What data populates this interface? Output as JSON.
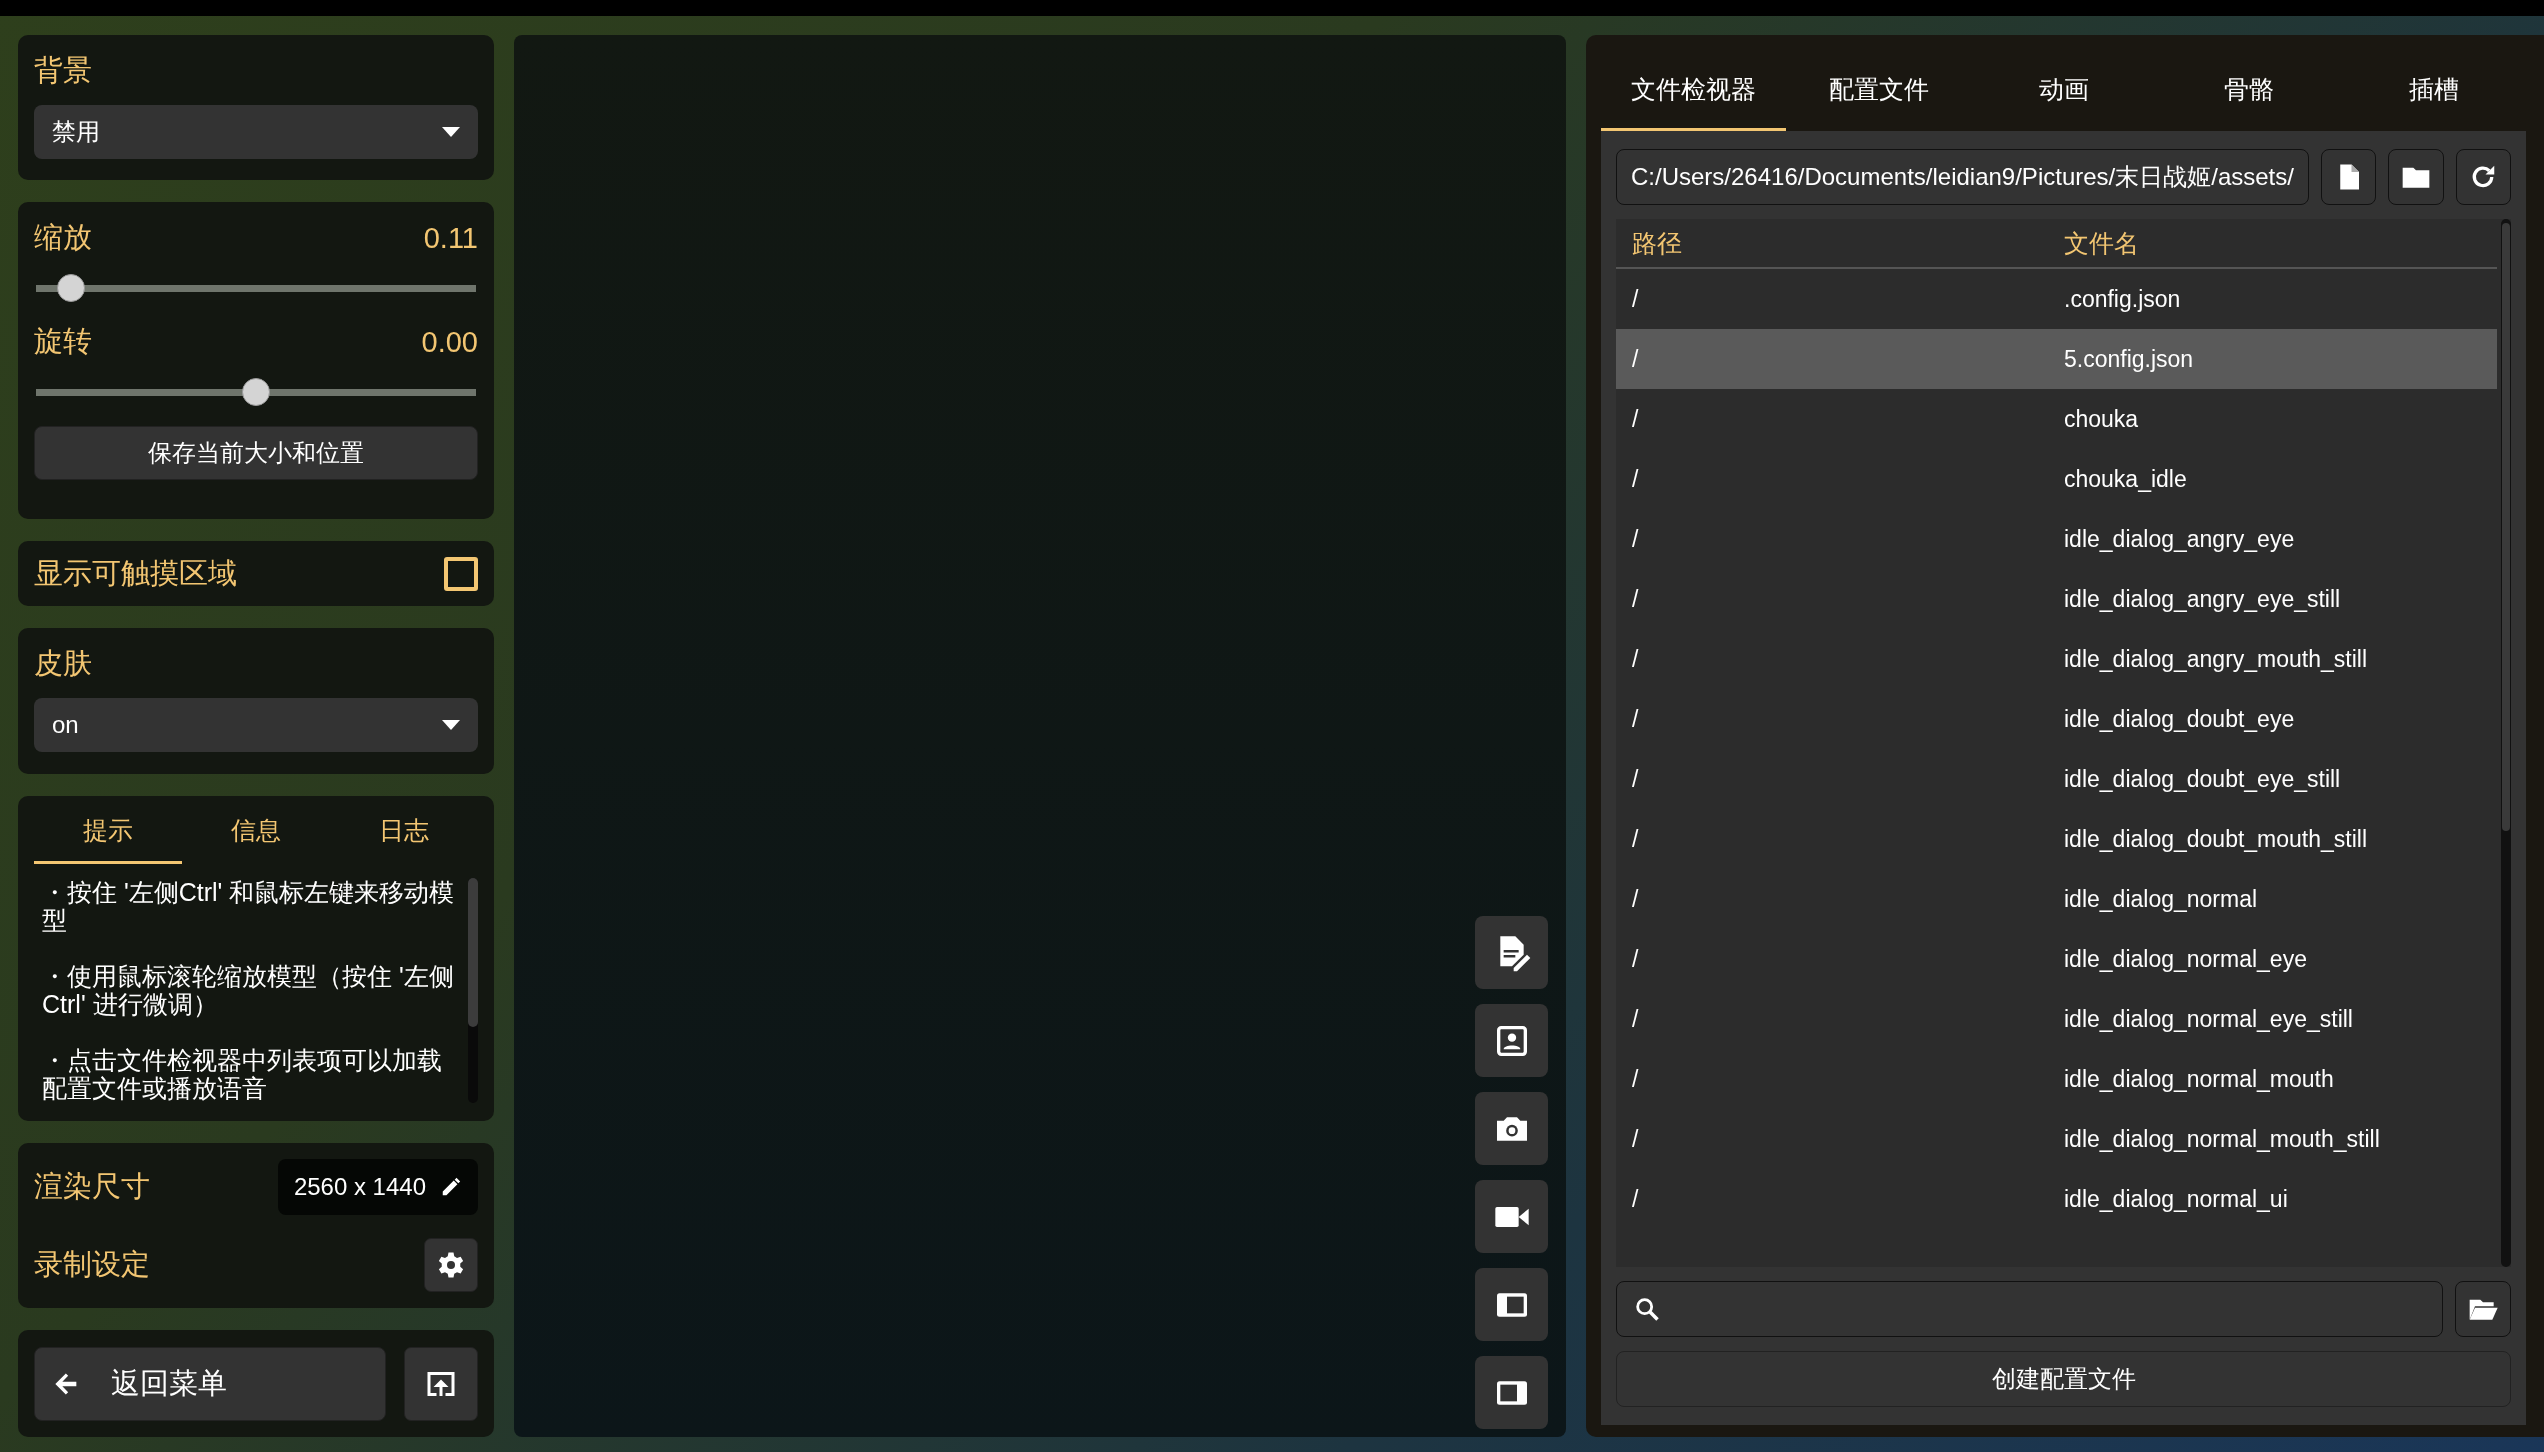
{
  "background": {
    "label": "背景",
    "value": "禁用"
  },
  "transform": {
    "sliders": [
      {
        "label": "缩放",
        "reading": "0.11",
        "level": 0.05
      },
      {
        "label": "旋转",
        "reading": "0.00",
        "level": 0.5
      }
    ],
    "save_button": "保存当前大小和位置"
  },
  "touch_area": {
    "label": "显示可触摸区域",
    "checked": false
  },
  "skin": {
    "label": "皮肤",
    "value": "on"
  },
  "info_tabs": [
    {
      "label": "提示",
      "selected": true
    },
    {
      "label": "信息",
      "selected": false
    },
    {
      "label": "日志",
      "selected": false
    }
  ],
  "hints": [
    "・按住 '左侧Ctrl' 和鼠标左键来移动模型",
    "・使用鼠标滚轮缩放模型（按住 '左侧Ctrl' 进行微调）",
    "・点击文件检视器中列表项可以加载配置文件或播放语音"
  ],
  "render": {
    "label": "渲染尺寸",
    "value": "2560 x 1440"
  },
  "record": {
    "label": "录制设定"
  },
  "back_button": "返回菜单",
  "toolbar": [
    {
      "kind": "edit-doc"
    },
    {
      "kind": "portrait"
    },
    {
      "kind": "camera"
    },
    {
      "kind": "video"
    },
    {
      "kind": "panel-left"
    },
    {
      "kind": "panel-right"
    }
  ],
  "right_tabs": [
    {
      "label": "文件检视器",
      "selected": true
    },
    {
      "label": "配置文件",
      "selected": false
    },
    {
      "label": "动画",
      "selected": false
    },
    {
      "label": "骨骼",
      "selected": false
    },
    {
      "label": "插槽",
      "selected": false
    }
  ],
  "path_field": {
    "value": "C:/Users/26416/Documents/leidian9/Pictures/末日战姬/assets/"
  },
  "table": {
    "columns": [
      "路径",
      "文件名"
    ],
    "rows": [
      {
        "path": "/",
        "name": ".config.json",
        "selected": false
      },
      {
        "path": "/",
        "name": "5.config.json",
        "selected": true
      },
      {
        "path": "/",
        "name": "chouka",
        "selected": false
      },
      {
        "path": "/",
        "name": "chouka_idle",
        "selected": false
      },
      {
        "path": "/",
        "name": "idle_dialog_angry_eye",
        "selected": false
      },
      {
        "path": "/",
        "name": "idle_dialog_angry_eye_still",
        "selected": false
      },
      {
        "path": "/",
        "name": "idle_dialog_angry_mouth_still",
        "selected": false
      },
      {
        "path": "/",
        "name": "idle_dialog_doubt_eye",
        "selected": false
      },
      {
        "path": "/",
        "name": "idle_dialog_doubt_eye_still",
        "selected": false
      },
      {
        "path": "/",
        "name": "idle_dialog_doubt_mouth_still",
        "selected": false
      },
      {
        "path": "/",
        "name": "idle_dialog_normal",
        "selected": false
      },
      {
        "path": "/",
        "name": "idle_dialog_normal_eye",
        "selected": false
      },
      {
        "path": "/",
        "name": "idle_dialog_normal_eye_still",
        "selected": false
      },
      {
        "path": "/",
        "name": "idle_dialog_normal_mouth",
        "selected": false
      },
      {
        "path": "/",
        "name": "idle_dialog_normal_mouth_still",
        "selected": false
      },
      {
        "path": "/",
        "name": "idle_dialog_normal_ui",
        "selected": false
      }
    ]
  },
  "create_button": "创建配置文件"
}
